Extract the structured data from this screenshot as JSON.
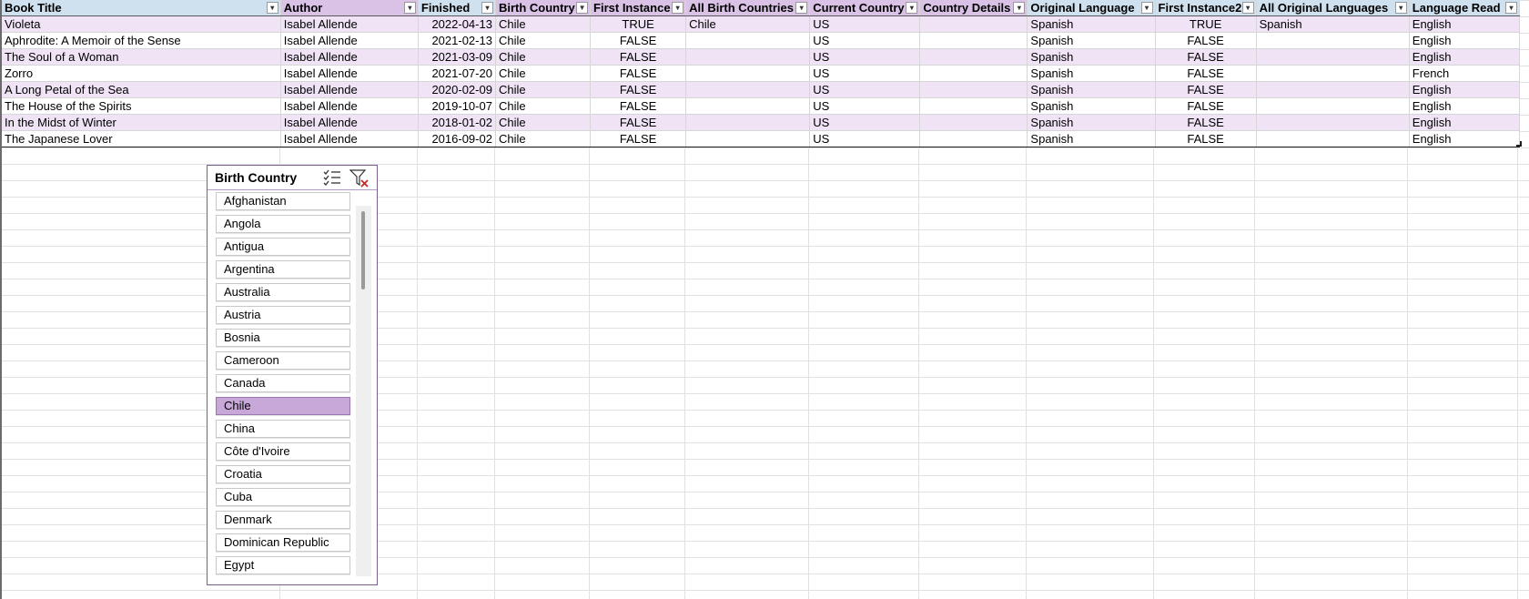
{
  "table": {
    "headers": [
      {
        "label": "Book Title",
        "style": "blue",
        "filtered": false
      },
      {
        "label": "Author",
        "style": "purple",
        "filtered": false
      },
      {
        "label": "Finished",
        "style": "blue",
        "filtered": false
      },
      {
        "label": "Birth Country",
        "style": "purple",
        "filtered": true
      },
      {
        "label": "First Instance",
        "style": "purple",
        "filtered": false
      },
      {
        "label": "All Birth Countries",
        "style": "purple",
        "filtered": false
      },
      {
        "label": "Current Country",
        "style": "purple",
        "filtered": false
      },
      {
        "label": "Country Details",
        "style": "purple",
        "filtered": false
      },
      {
        "label": "Original Language",
        "style": "blue",
        "filtered": false
      },
      {
        "label": "First Instance2",
        "style": "blue",
        "filtered": false
      },
      {
        "label": "All Original Languages",
        "style": "blue",
        "filtered": false
      },
      {
        "label": "Language Read",
        "style": "blue",
        "filtered": false
      }
    ],
    "rows": [
      [
        "Violeta",
        "Isabel Allende",
        "2022-04-13",
        "Chile",
        "TRUE",
        "Chile",
        "US",
        "",
        "Spanish",
        "TRUE",
        "Spanish",
        "English"
      ],
      [
        "Aphrodite: A Memoir of the Sense",
        "Isabel Allende",
        "2021-02-13",
        "Chile",
        "FALSE",
        "",
        "US",
        "",
        "Spanish",
        "FALSE",
        "",
        "English"
      ],
      [
        "The Soul of a Woman",
        "Isabel Allende",
        "2021-03-09",
        "Chile",
        "FALSE",
        "",
        "US",
        "",
        "Spanish",
        "FALSE",
        "",
        "English"
      ],
      [
        "Zorro",
        "Isabel Allende",
        "2021-07-20",
        "Chile",
        "FALSE",
        "",
        "US",
        "",
        "Spanish",
        "FALSE",
        "",
        "French"
      ],
      [
        "A Long Petal of the Sea",
        "Isabel Allende",
        "2020-02-09",
        "Chile",
        "FALSE",
        "",
        "US",
        "",
        "Spanish",
        "FALSE",
        "",
        "English"
      ],
      [
        "The House of the Spirits",
        "Isabel Allende",
        "2019-10-07",
        "Chile",
        "FALSE",
        "",
        "US",
        "",
        "Spanish",
        "FALSE",
        "",
        "English"
      ],
      [
        "In the Midst of Winter",
        "Isabel Allende",
        "2018-01-02",
        "Chile",
        "FALSE",
        "",
        "US",
        "",
        "Spanish",
        "FALSE",
        "",
        "English"
      ],
      [
        "The Japanese Lover",
        "Isabel Allende",
        "2016-09-02",
        "Chile",
        "FALSE",
        "",
        "US",
        "",
        "Spanish",
        "FALSE",
        "",
        "English"
      ]
    ]
  },
  "slicer": {
    "title": "Birth Country",
    "multi_select_icon": "multi-select-icon",
    "clear_filter_icon": "clear-filter-icon",
    "items": [
      {
        "label": "Afghanistan",
        "selected": false
      },
      {
        "label": "Angola",
        "selected": false
      },
      {
        "label": "Antigua",
        "selected": false
      },
      {
        "label": "Argentina",
        "selected": false
      },
      {
        "label": "Australia",
        "selected": false
      },
      {
        "label": "Austria",
        "selected": false
      },
      {
        "label": "Bosnia",
        "selected": false
      },
      {
        "label": "Cameroon",
        "selected": false
      },
      {
        "label": "Canada",
        "selected": false
      },
      {
        "label": "Chile",
        "selected": true
      },
      {
        "label": "China",
        "selected": false
      },
      {
        "label": "Côte d'Ivoire",
        "selected": false
      },
      {
        "label": "Croatia",
        "selected": false
      },
      {
        "label": "Cuba",
        "selected": false
      },
      {
        "label": "Denmark",
        "selected": false
      },
      {
        "label": "Dominican Republic",
        "selected": false
      },
      {
        "label": "Egypt",
        "selected": false
      }
    ]
  },
  "colors": {
    "header_purple": "#d9c2e6",
    "header_blue": "#cfe0ee",
    "row_band": "#efe3f5",
    "slicer_selected": "#c7a8d9"
  }
}
